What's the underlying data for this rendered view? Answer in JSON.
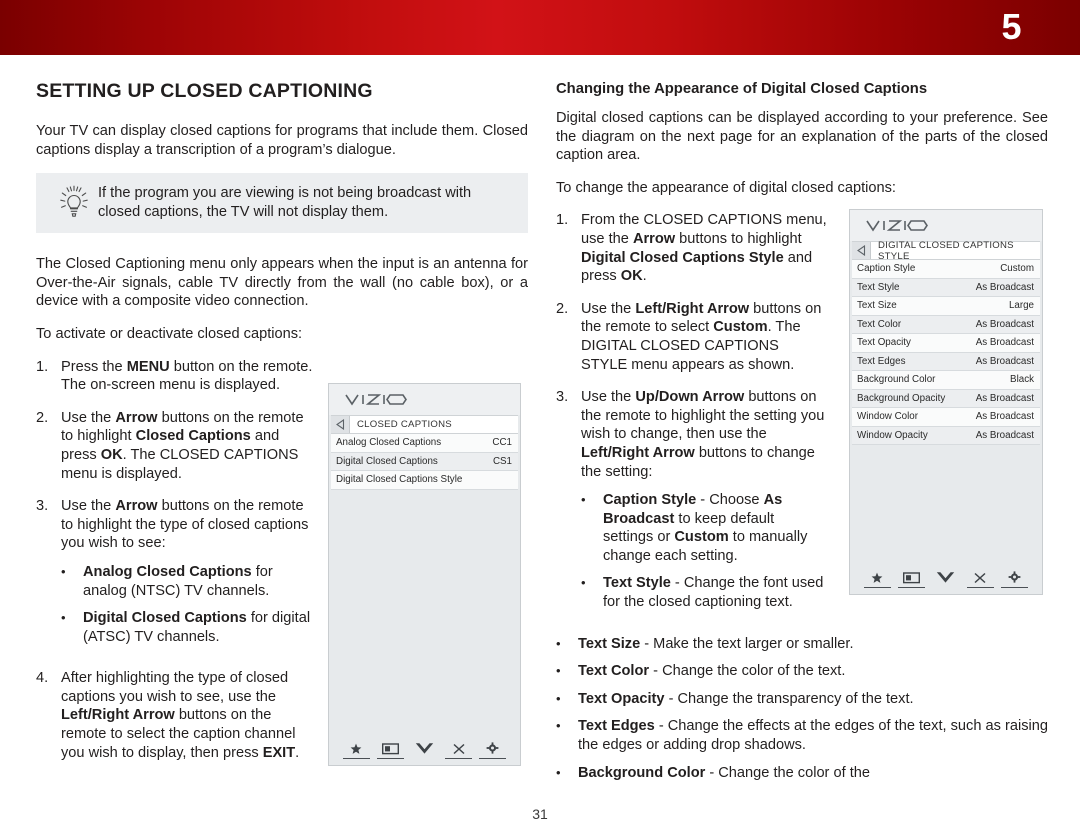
{
  "banner": {
    "chapter_number": "5"
  },
  "page": {
    "number": "31"
  },
  "left": {
    "title": "SETTING UP CLOSED CAPTIONING",
    "intro": "Your TV can display closed captions for programs that include them. Closed captions display a transcription of a program’s dialogue.",
    "tip": {
      "icon": "lightbulb-icon",
      "text": "If the program you are viewing is not being broadcast with closed captions, the TV will not display them."
    },
    "note": "The Closed Captioning menu only appears when the input is an antenna for Over-the-Air signals, cable TV directly from the wall (no cable box), or a device with a composite video connection.",
    "lead_in": "To activate or deactivate closed captions:",
    "steps": [
      {
        "num": "1.",
        "parts": [
          {
            "t": "Press the ",
            "b": false
          },
          {
            "t": "MENU",
            "b": true
          },
          {
            "t": " button on the remote. The on-screen menu is displayed.",
            "b": false
          }
        ]
      },
      {
        "num": "2.",
        "parts": [
          {
            "t": "Use the ",
            "b": false
          },
          {
            "t": "Arrow",
            "b": true
          },
          {
            "t": " buttons on the remote to highlight ",
            "b": false
          },
          {
            "t": "Closed Captions",
            "b": true
          },
          {
            "t": " and press ",
            "b": false
          },
          {
            "t": "OK",
            "b": true
          },
          {
            "t": ". The CLOSED CAPTIONS menu is displayed.",
            "b": false
          }
        ]
      },
      {
        "num": "3.",
        "parts": [
          {
            "t": "Use the ",
            "b": false
          },
          {
            "t": "Arrow",
            "b": true
          },
          {
            "t": " buttons on the remote to highlight the type of closed captions you wish to see:",
            "b": false
          }
        ],
        "bullets": [
          {
            "parts": [
              {
                "t": "Analog Closed Captions",
                "b": true
              },
              {
                "t": " for analog (NTSC) TV channels.",
                "b": false
              }
            ]
          },
          {
            "parts": [
              {
                "t": "Digital Closed Captions",
                "b": true
              },
              {
                "t": " for digital (ATSC) TV channels.",
                "b": false
              }
            ]
          }
        ]
      },
      {
        "num": "4.",
        "parts": [
          {
            "t": "After highlighting the type of closed captions you wish to see, use the ",
            "b": false
          },
          {
            "t": "Left/Right Arrow",
            "b": true
          },
          {
            "t": " buttons on the remote to select the caption channel you wish to display, then press ",
            "b": false
          },
          {
            "t": "EXIT",
            "b": true
          },
          {
            "t": ".",
            "b": false
          }
        ]
      }
    ]
  },
  "right": {
    "title": "Changing the Appearance of Digital Closed Captions",
    "intro": "Digital closed captions can be displayed according to your preference. See the diagram on the next page for an explanation of the parts of the closed caption area.",
    "lead_in": "To change the appearance of digital closed captions:",
    "steps": [
      {
        "num": "1.",
        "parts": [
          {
            "t": "From the CLOSED CAPTIONS menu, use the ",
            "b": false
          },
          {
            "t": "Arrow",
            "b": true
          },
          {
            "t": " buttons to highlight ",
            "b": false
          },
          {
            "t": "Digital Closed Captions Style",
            "b": true
          },
          {
            "t": " and press ",
            "b": false
          },
          {
            "t": "OK",
            "b": true
          },
          {
            "t": ".",
            "b": false
          }
        ]
      },
      {
        "num": "2.",
        "parts": [
          {
            "t": "Use the ",
            "b": false
          },
          {
            "t": "Left/Right Arrow",
            "b": true
          },
          {
            "t": " buttons on the remote to select ",
            "b": false
          },
          {
            "t": "Custom",
            "b": true
          },
          {
            "t": ". The DIGITAL CLOSED CAPTIONS STYLE menu appears as shown.",
            "b": false
          }
        ]
      },
      {
        "num": "3.",
        "parts": [
          {
            "t": "Use the ",
            "b": false
          },
          {
            "t": "Up/Down Arrow",
            "b": true
          },
          {
            "t": " buttons on the remote to highlight the setting you wish to change, then use the ",
            "b": false
          },
          {
            "t": "Left/Right Arrow",
            "b": true
          },
          {
            "t": " buttons to change the setting:",
            "b": false
          }
        ],
        "bullets_narrow": [
          {
            "parts": [
              {
                "t": "Caption Style",
                "b": true
              },
              {
                "t": " - Choose ",
                "b": false
              },
              {
                "t": "As Broadcast",
                "b": true
              },
              {
                "t": " to keep default settings or ",
                "b": false
              },
              {
                "t": "Custom",
                "b": true
              },
              {
                "t": " to manually change each setting.",
                "b": false
              }
            ]
          },
          {
            "parts": [
              {
                "t": "Text Style",
                "b": true
              },
              {
                "t": "  - Change the font used for the closed captioning text.",
                "b": false
              }
            ]
          }
        ]
      }
    ],
    "bullets_wide": [
      {
        "parts": [
          {
            "t": "Text Size",
            "b": true
          },
          {
            "t": " - Make the text larger or smaller.",
            "b": false
          }
        ]
      },
      {
        "parts": [
          {
            "t": "Text Color",
            "b": true
          },
          {
            "t": " - Change the color of the text.",
            "b": false
          }
        ]
      },
      {
        "parts": [
          {
            "t": "Text Opacity",
            "b": true
          },
          {
            "t": " - Change the transparency of the text.",
            "b": false
          }
        ]
      },
      {
        "parts": [
          {
            "t": "Text Edges",
            "b": true
          },
          {
            "t": " - Change the effects at the edges of the text, such as raising the edges or adding drop shadows.",
            "b": false
          }
        ]
      },
      {
        "parts": [
          {
            "t": "Background Color",
            "b": true
          },
          {
            "t": " - Change the color of the",
            "b": false
          }
        ]
      }
    ]
  },
  "tv_menu_left": {
    "logo": "VIZIO",
    "back_icon": "back-arrow-icon",
    "breadcrumb": "CLOSED CAPTIONS",
    "rows": [
      {
        "label": "Analog Closed Captions",
        "value": "CC1"
      },
      {
        "label": "Digital Closed Captions",
        "value": "CS1"
      },
      {
        "label": "Digital Closed Captions Style",
        "value": ""
      }
    ],
    "icons": [
      "star-icon",
      "picture-icon",
      "chevron-down-icon",
      "close-x-icon",
      "gear-icon"
    ]
  },
  "tv_menu_right": {
    "logo": "VIZIO",
    "back_icon": "back-arrow-icon",
    "breadcrumb": "DIGITAL CLOSED CAPTIONS STYLE",
    "rows": [
      {
        "label": "Caption Style",
        "value": "Custom"
      },
      {
        "label": "Text Style",
        "value": "As Broadcast"
      },
      {
        "label": "Text Size",
        "value": "Large"
      },
      {
        "label": "Text Color",
        "value": "As Broadcast"
      },
      {
        "label": "Text Opacity",
        "value": "As Broadcast"
      },
      {
        "label": "Text Edges",
        "value": "As Broadcast"
      },
      {
        "label": "Background Color",
        "value": "Black"
      },
      {
        "label": "Background Opacity",
        "value": "As Broadcast"
      },
      {
        "label": "Window Color",
        "value": "As Broadcast"
      },
      {
        "label": "Window Opacity",
        "value": "As Broadcast"
      }
    ],
    "icons": [
      "star-icon",
      "picture-icon",
      "chevron-down-icon",
      "close-x-icon",
      "gear-icon"
    ]
  },
  "colors": {
    "banner_red": "#c00d0d",
    "banner_dark": "#7a0000",
    "menu_bg": "#e7eaec"
  }
}
